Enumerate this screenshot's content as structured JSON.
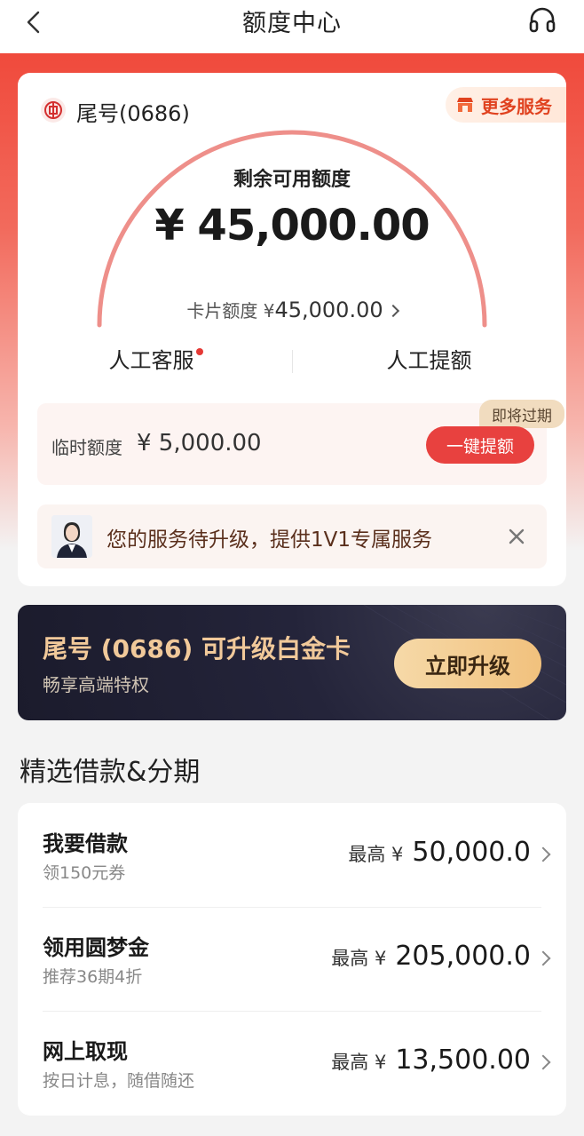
{
  "header": {
    "title": "额度中心",
    "back_icon": "back-arrow-icon",
    "support_icon": "headset-icon"
  },
  "credit_card": {
    "tail_number": "尾号(0686)",
    "more_services": "更多服务",
    "available_label": "剩余可用额度",
    "available_amount": "¥ 45,000.00",
    "card_limit_label": "卡片额度 ¥",
    "card_limit_value": "45,000.00",
    "services": {
      "manual_service": "人工客服",
      "manual_increase": "人工提额"
    },
    "temp_limit": {
      "label": "临时额度",
      "amount": "¥ 5,000.00",
      "badge": "即将过期",
      "button": "一键提额"
    },
    "upgrade_notice": "您的服务待升级，提供1V1专属服务"
  },
  "platinum": {
    "title": "尾号 (0686) 可升级白金卡",
    "subtitle": "畅享高端特权",
    "button": "立即升级"
  },
  "section_title": "精选借款&分期",
  "loans": [
    {
      "name": "我要借款",
      "desc": "领150元券",
      "max_label": "最高 ¥",
      "amount": "50,000.0"
    },
    {
      "name": "领用圆梦金",
      "desc": "推荐36期4折",
      "max_label": "最高 ¥",
      "amount": "205,000.0"
    },
    {
      "name": "网上取现",
      "desc": "按日计息，随借随还",
      "max_label": "最高 ¥",
      "amount": "13,500.00"
    }
  ],
  "colors": {
    "brand_red": "#e8413f",
    "gold": "#f1c99a",
    "dark_banner": "#1b1b2c"
  }
}
